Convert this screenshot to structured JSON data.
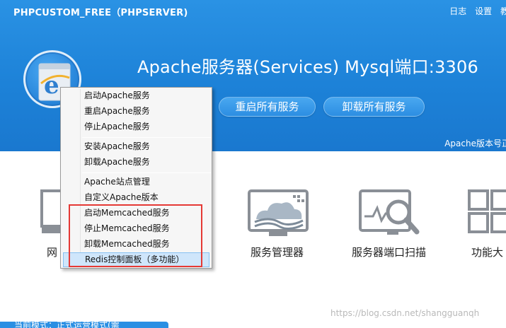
{
  "header": {
    "app_title": "PHPCUSTOM_FREE（PHPSERVER)",
    "links": [
      "日志",
      "设置",
      "教"
    ],
    "status": "Apache服务器(Services)  Mysql端口:3306",
    "buttons": {
      "restart_all": "重启所有服务",
      "uninstall_all": "卸载所有服务"
    },
    "version_text": "Apache版本号正"
  },
  "tiles": [
    {
      "label": "网",
      "icon": "monitor-icon"
    },
    {
      "label": "服务管理器",
      "icon": "cloud-service-icon"
    },
    {
      "label": "服务器端口扫描",
      "icon": "magnifier-scan-icon"
    },
    {
      "label": "功能大",
      "icon": "grid-apps-icon"
    }
  ],
  "context_menu": {
    "items": [
      "启动Apache服务",
      "重启Apache服务",
      "停止Apache服务",
      "安装Apache服务",
      "卸载Apache服务",
      "Apache站点管理",
      "自定义Apache版本",
      "启动Memcached服务",
      "停止Memcached服务",
      "卸载Memcached服务",
      "Redis控制面板（多功能）"
    ],
    "highlighted_index": 10
  },
  "bottom": {
    "status_text": "当前模式：正式运营模式(需"
  },
  "watermark": "https://blog.csdn.net/shangguanqh",
  "colors": {
    "header_blue": "#1d82d8",
    "highlight_bg": "#cfe6fb",
    "red_annotation": "#e53935"
  }
}
